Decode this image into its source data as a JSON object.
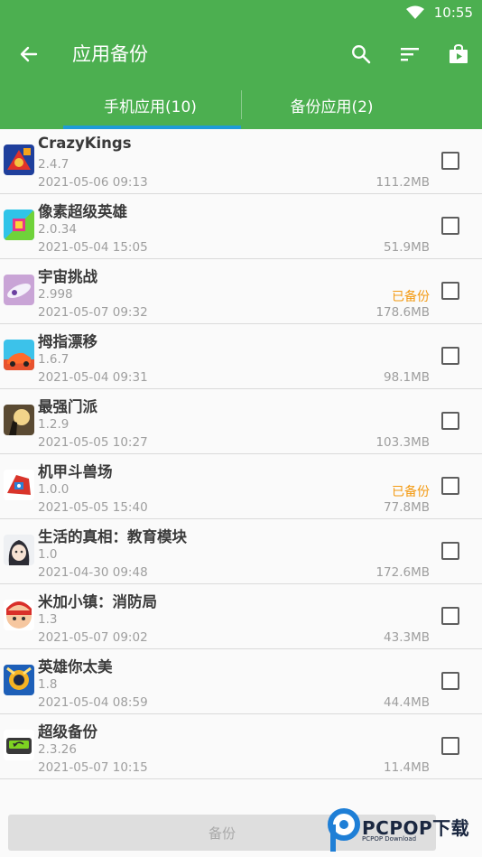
{
  "status_bar": {
    "time": "10:55"
  },
  "toolbar": {
    "title": "应用备份"
  },
  "tabs": [
    {
      "label": "手机应用(10)",
      "active": true
    },
    {
      "label": "备份应用(2)",
      "active": false
    }
  ],
  "apps": [
    {
      "name": "CrazyKings",
      "version": "2.4.7",
      "date": "2021-05-06 09:13",
      "size": "111.2MB",
      "status": "",
      "icon": "crazykings-icon"
    },
    {
      "name": "像素超级英雄",
      "version": "2.0.34",
      "date": "2021-05-04 15:05",
      "size": "51.9MB",
      "status": "",
      "icon": "pixel-heroes-icon"
    },
    {
      "name": "宇宙挑战",
      "version": "2.998",
      "date": "2021-05-07 09:32",
      "size": "178.6MB",
      "status": "已备份",
      "icon": "space-challenge-icon"
    },
    {
      "name": "拇指漂移",
      "version": "1.6.7",
      "date": "2021-05-04 09:31",
      "size": "98.1MB",
      "status": "",
      "icon": "thumb-drift-icon"
    },
    {
      "name": "最强门派",
      "version": "1.2.9",
      "date": "2021-05-05 10:27",
      "size": "103.3MB",
      "status": "",
      "icon": "strongest-sect-icon"
    },
    {
      "name": "机甲斗兽场",
      "version": "1.0.0",
      "date": "2021-05-05 15:40",
      "size": "77.8MB",
      "status": "已备份",
      "icon": "mech-arena-icon"
    },
    {
      "name": "生活的真相：教育模块",
      "version": "1.0",
      "date": "2021-04-30 09:48",
      "size": "172.6MB",
      "status": "",
      "icon": "truth-of-life-icon"
    },
    {
      "name": "米加小镇：消防局",
      "version": "1.3",
      "date": "2021-05-07 09:02",
      "size": "43.3MB",
      "status": "",
      "icon": "miga-town-icon"
    },
    {
      "name": "英雄你太美",
      "version": "1.8",
      "date": "2021-05-04 08:59",
      "size": "44.4MB",
      "status": "",
      "icon": "hero-beautiful-icon"
    },
    {
      "name": "超级备份",
      "version": "2.3.26",
      "date": "2021-05-07 10:15",
      "size": "11.4MB",
      "status": "",
      "icon": "super-backup-icon"
    }
  ],
  "footer": {
    "backup_label": "备份"
  },
  "watermark": {
    "brand": "PCPOP下载",
    "sub": "PCPOP Download"
  },
  "colors": {
    "primary": "#4caf50",
    "indicator": "#1e9bd7",
    "backed_up": "#f39a12"
  }
}
